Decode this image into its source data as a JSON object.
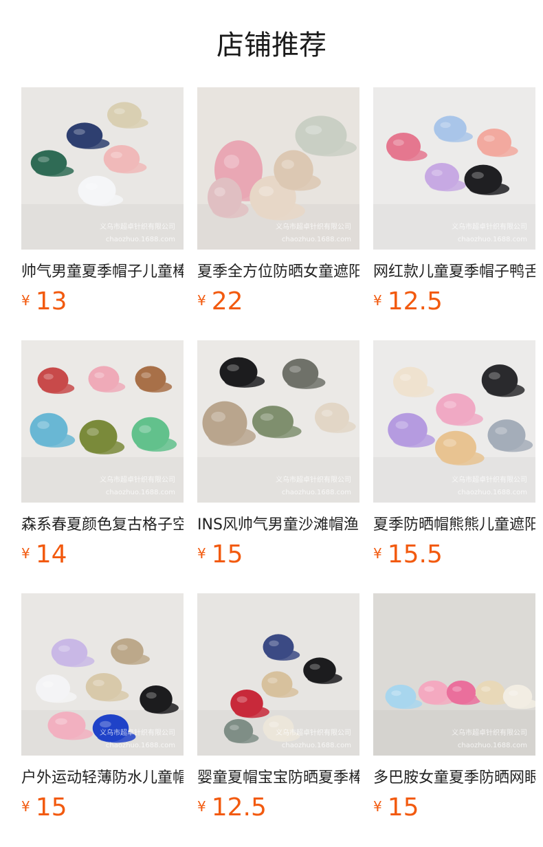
{
  "header": {
    "title": "店铺推荐"
  },
  "products": [
    {
      "name": "帅气男童夏季帽子儿童棒球帽",
      "currency": "¥",
      "price": "13",
      "watermark_1": "义乌市超卓针织有限公司",
      "watermark_2": "chaozhuo.1688.com",
      "bg": "#e9e7e4",
      "colors": [
        "#2f6b55",
        "#2e3f70",
        "#d9cfb2",
        "#f0b9b9",
        "#f5f6f8"
      ]
    },
    {
      "name": "夏季全方位防晒女童遮阳帽",
      "currency": "¥",
      "price": "22",
      "watermark_1": "义乌市超卓针织有限公司",
      "watermark_2": "chaozhuo.1688.com",
      "bg": "#e8e4df",
      "colors": [
        "#e9a7b4",
        "#e7d7c7",
        "#c9cfc4",
        "#dcc8b3",
        "#e0bfc2"
      ]
    },
    {
      "name": "网红款儿童夏季帽子鸭舌帽",
      "currency": "¥",
      "price": "12.5",
      "watermark_1": "义乌市超卓针织有限公司",
      "watermark_2": "chaozhuo.1688.com",
      "bg": "#ecebea",
      "colors": [
        "#e5778f",
        "#a9c5e9",
        "#f2a99f",
        "#c7a9e3",
        "#1f1f22"
      ]
    },
    {
      "name": "森系春夏颜色复古格子空顶帽",
      "currency": "¥",
      "price": "14",
      "watermark_1": "义乌市超卓针织有限公司",
      "watermark_2": "chaozhuo.1688.com",
      "bg": "#ebe9e6",
      "colors": [
        "#c84a4a",
        "#efaab8",
        "#a87048",
        "#69b7d4",
        "#7a8a3a",
        "#62c18c"
      ]
    },
    {
      "name": "INS风帅气男童沙滩帽渔夫帽",
      "currency": "¥",
      "price": "15",
      "watermark_1": "义乌市超卓针织有限公司",
      "watermark_2": "chaozhuo.1688.com",
      "bg": "#ebe9e6",
      "colors": [
        "#1c1c1e",
        "#6f7169",
        "#b9a58d",
        "#7f8f6e",
        "#e2d6c6"
      ]
    },
    {
      "name": "夏季防晒帽熊熊儿童遮阳帽",
      "currency": "¥",
      "price": "15.5",
      "watermark_1": "义乌市超卓针织有限公司",
      "watermark_2": "chaozhuo.1688.com",
      "bg": "#ecebea",
      "colors": [
        "#efe2cf",
        "#2a2a2d",
        "#f0a9c4",
        "#b59be0",
        "#e8c391",
        "#a4adb9"
      ]
    },
    {
      "name": "户外运动轻薄防水儿童帽子",
      "currency": "¥",
      "price": "15",
      "watermark_1": "义乌市超卓针织有限公司",
      "watermark_2": "chaozhuo.1688.com",
      "bg": "#e9e7e4",
      "colors": [
        "#c9b8e6",
        "#bca88a",
        "#f4f4f6",
        "#d8c9aa",
        "#f2b0c0",
        "#1f42c8",
        "#1c1c1e"
      ]
    },
    {
      "name": "婴童夏帽宝宝防晒夏季棒球帽",
      "currency": "¥",
      "price": "12.5",
      "watermark_1": "义乌市超卓针织有限公司",
      "watermark_2": "chaozhuo.1688.com",
      "bg": "#e7e5e2",
      "colors": [
        "#3b4a84",
        "#c8293a",
        "#d7c19d",
        "#1c1c1e",
        "#ece6da",
        "#7f8e86"
      ]
    },
    {
      "name": "多巴胺女童夏季防晒网眼帽",
      "currency": "¥",
      "price": "15",
      "watermark_1": "义乌市超卓针织有限公司",
      "watermark_2": "chaozhuo.1688.com",
      "bg": "#dcdad6",
      "colors": [
        "#a8d6ee",
        "#f4a9c0",
        "#ea6f9c",
        "#e8d8b8",
        "#f2ede3"
      ]
    }
  ]
}
